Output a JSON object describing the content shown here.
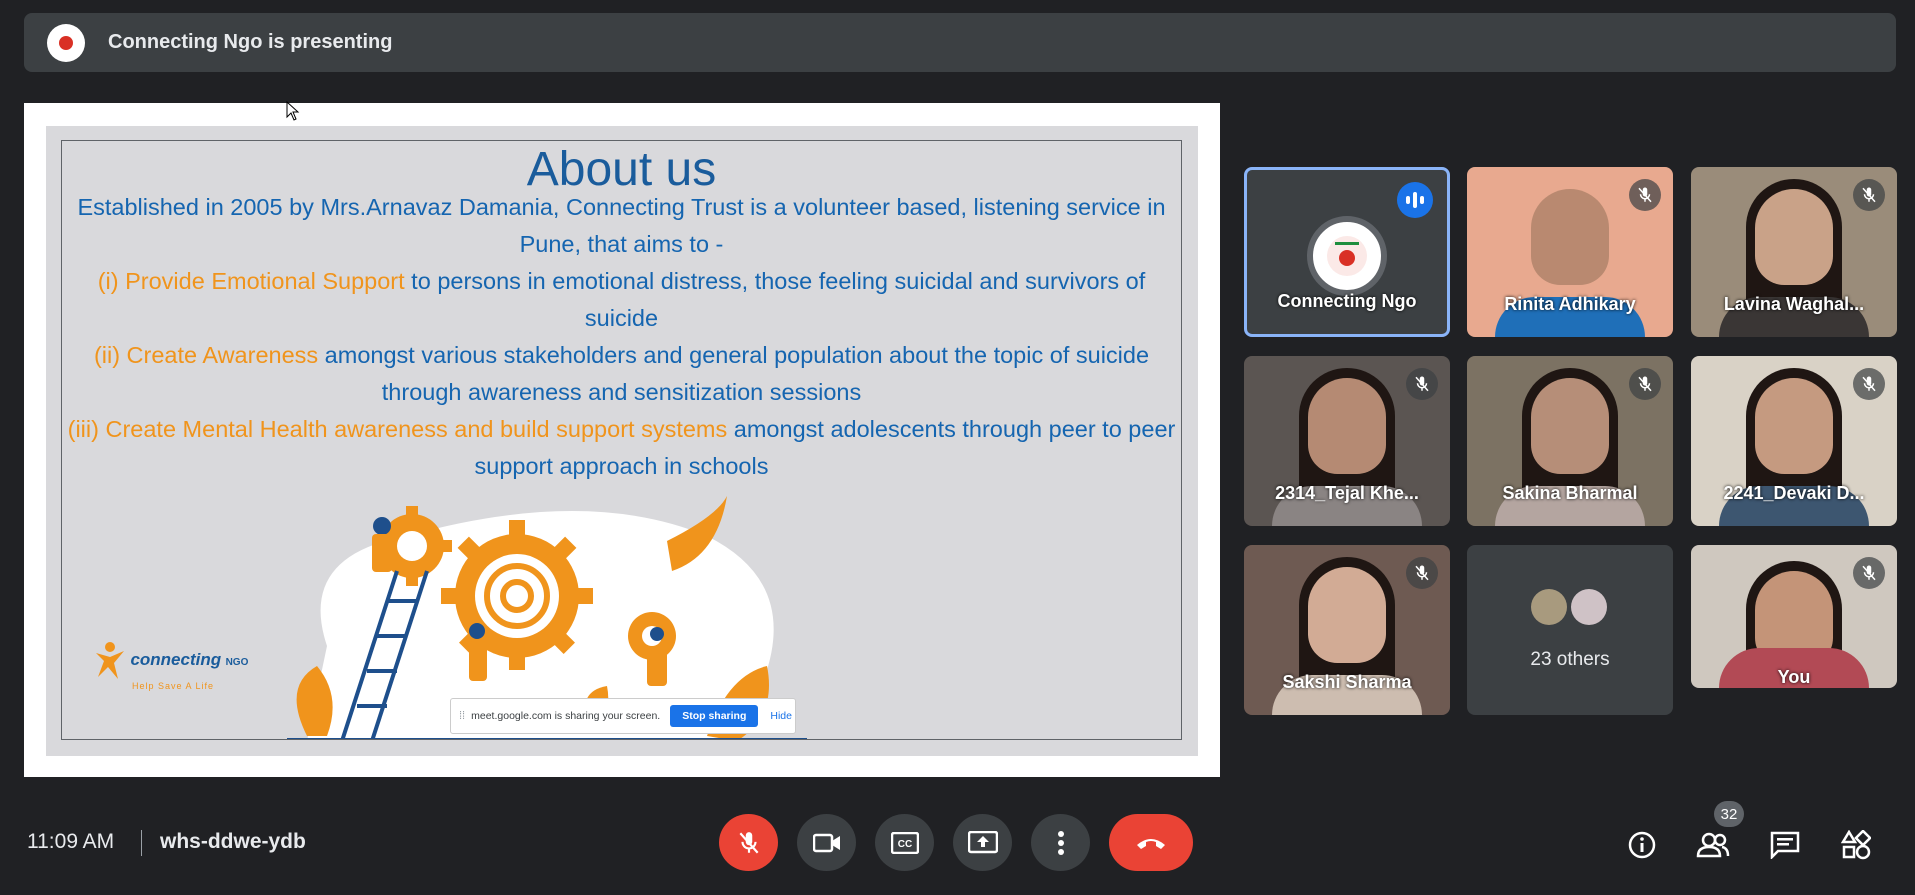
{
  "banner": {
    "text": "Connecting Ngo is presenting"
  },
  "slide": {
    "title": "About us",
    "intro": "Established in 2005 by Mrs.Arnavaz Damania, Connecting Trust is a volunteer based, listening service in Pune, that aims to -",
    "points": [
      {
        "highlight": "(i) Provide Emotional Support",
        "rest": " to persons in emotional distress, those feeling suicidal and survivors of suicide"
      },
      {
        "highlight": "(ii) Create Awareness",
        "rest": " amongst various stakeholders and general population about the topic of suicide through awareness and sensitization sessions"
      },
      {
        "highlight": "(iii) Create Mental Health awareness and build support systems",
        "rest": " amongst adolescents through peer to peer support approach in schools"
      }
    ],
    "logo_brand": "connecting",
    "logo_ngo": "NGO",
    "logo_tagline": "Help Save A Life"
  },
  "share_bar": {
    "message": "meet.google.com is sharing your screen.",
    "stop_label": "Stop sharing",
    "hide_label": "Hide"
  },
  "participants": [
    {
      "name": "Connecting Ngo",
      "speaking": true,
      "muted": false
    },
    {
      "name": "Rinita Adhikary",
      "muted": true,
      "bg": "#e8a98f",
      "body": "#1f6fb8"
    },
    {
      "name": "Lavina Waghal...",
      "muted": true,
      "bg": "#9a8c7a",
      "body": "#3a3635"
    },
    {
      "name": "2314_Tejal Khe...",
      "muted": true,
      "bg": "#5b5552",
      "body": "#8a8483"
    },
    {
      "name": "Sakina Bharmal",
      "muted": true,
      "bg": "#7c7263",
      "body": "#b4a5a0"
    },
    {
      "name": "2241_Devaki D...",
      "muted": true,
      "bg": "#d9d2c6",
      "body": "#3d5670"
    },
    {
      "name": "Sakshi Sharma",
      "muted": true,
      "bg": "#6e5a52",
      "body": "#cdbdb0"
    },
    {
      "name": "You",
      "muted": true,
      "bg": "#cfc8bf",
      "body": "#b24a55"
    }
  ],
  "others": {
    "label": "23 others"
  },
  "bottom": {
    "time": "11:09 AM",
    "meeting_code": "whs-ddwe-ydb",
    "participant_count": "32"
  },
  "colors": {
    "background": "#202124",
    "end_call": "#ea4335",
    "accent": "#1a73e8",
    "slide_orange": "#f0941c",
    "slide_blue": "#1565b0"
  }
}
